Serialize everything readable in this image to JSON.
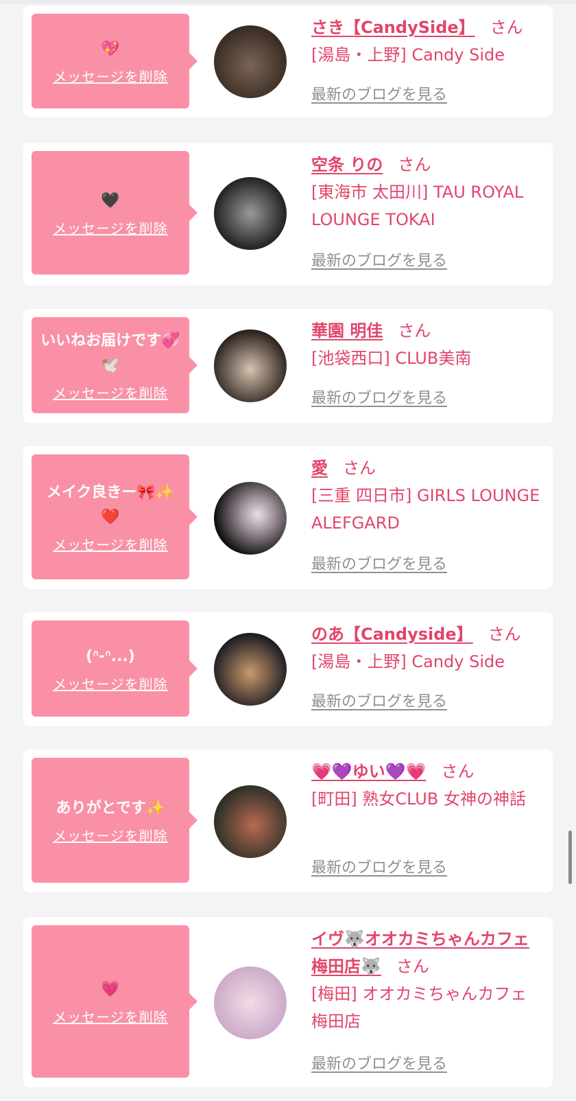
{
  "colors": {
    "bubble": "#f990a6",
    "name": "#e2456a",
    "link": "#8f8f8f"
  },
  "labels": {
    "delete": "メッセージを削除",
    "blog": "最新のブログを見る",
    "san": "さん"
  },
  "cards": [
    {
      "message": "💖",
      "name": "さき【CandySide】",
      "shop": "[湯島・上野] Candy Side",
      "avatar_colors": [
        "#3a2c24",
        "#7a6555"
      ]
    },
    {
      "message": "🖤",
      "name": "空条 りの",
      "shop": "[東海市 太田川] TAU ROYAL LOUNGE TOKAI",
      "avatar_colors": [
        "#1a1a1a",
        "#9a9a9a"
      ]
    },
    {
      "message": "いいねお届けです💞🕊️",
      "name": "華園 明佳",
      "shop": "[池袋西口] CLUB美南",
      "avatar_colors": [
        "#2b221d",
        "#d7c2b0"
      ]
    },
    {
      "message": "メイク良きー🎀✨❤️",
      "name": "愛",
      "shop": "[三重 四日市] GIRLS LOUNGE ALEFGARD",
      "avatar_colors": [
        "#111111",
        "#e8e1e6"
      ]
    },
    {
      "message": "(ᐢ-ᐢ...)",
      "name": "のあ【Candyside】",
      "shop": "[湯島・上野] Candy Side",
      "avatar_colors": [
        "#1d1b24",
        "#c99a6a"
      ]
    },
    {
      "message": "ありがとです✨",
      "name": "💗💜ゆい💜💗",
      "shop": "[町田] 熟女CLUB 女神の神話",
      "avatar_colors": [
        "#2a2f25",
        "#b86a54"
      ]
    },
    {
      "message": "💗",
      "name": "イヴ🐺オオカミちゃんカフェ梅田店🐺",
      "shop": "[梅田] オオカミちゃんカフェ梅田店",
      "avatar_colors": [
        "#caa8c8",
        "#f2dbe6"
      ]
    }
  ]
}
